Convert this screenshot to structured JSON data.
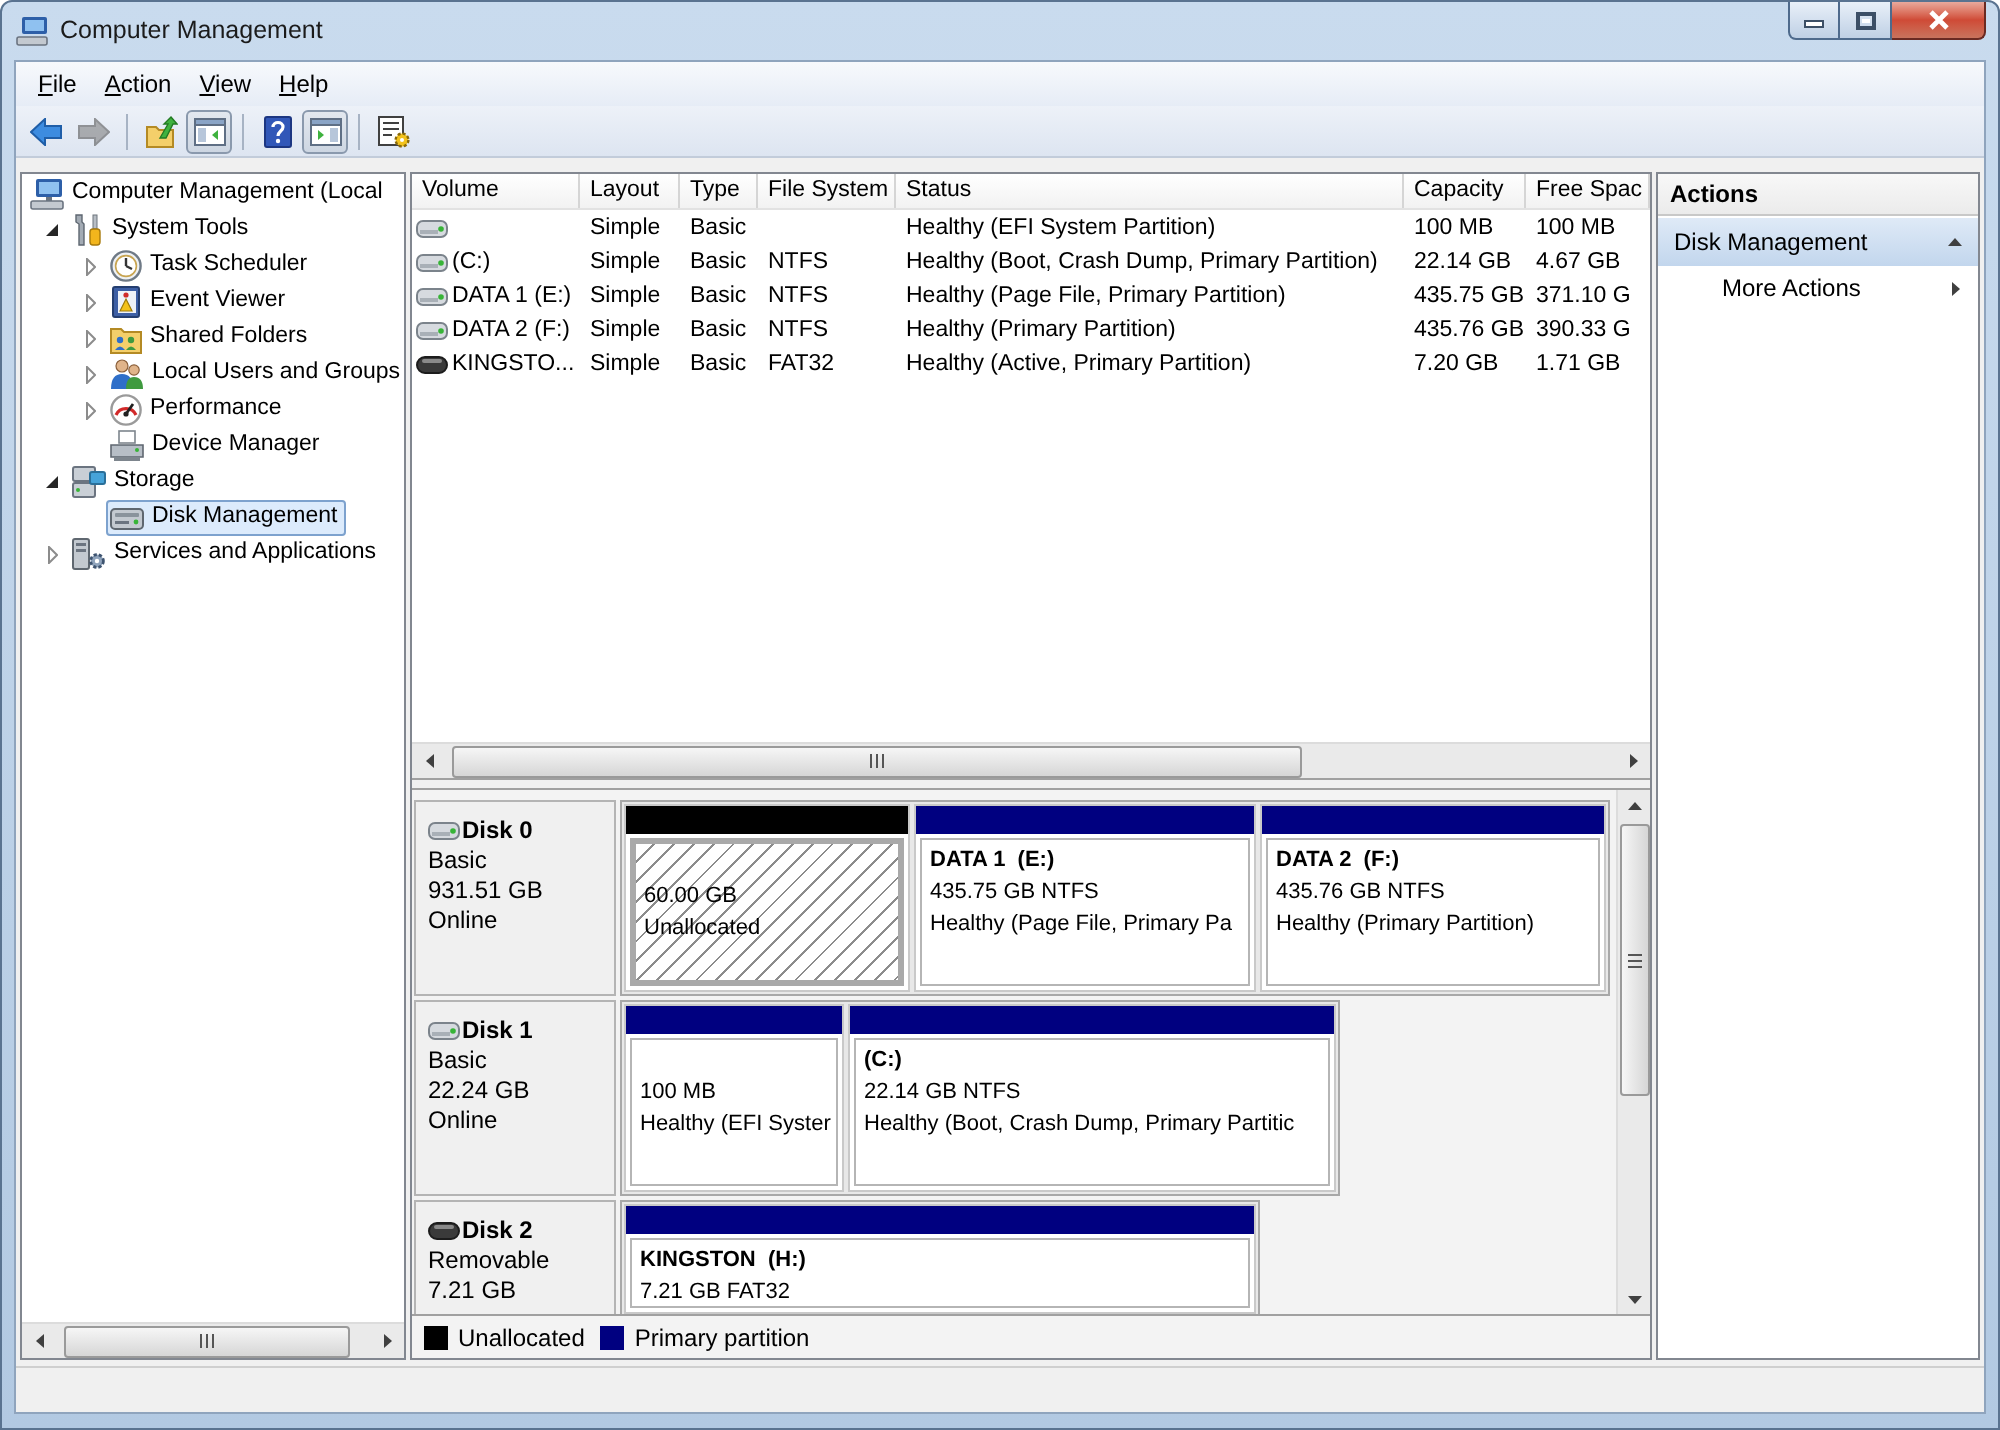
{
  "window": {
    "title": "Computer Management"
  },
  "menu": [
    "File",
    "Action",
    "View",
    "Help"
  ],
  "toolbar": [
    {
      "disabled": false,
      "pressed": false
    },
    {
      "disabled": true,
      "pressed": false
    },
    {
      "disabled": false,
      "pressed": false
    },
    {
      "disabled": false,
      "pressed": true
    },
    {
      "disabled": false,
      "pressed": false
    },
    {
      "disabled": false,
      "pressed": true
    },
    {
      "disabled": false,
      "pressed": false
    }
  ],
  "tree": [
    {
      "label": "Computer Management (Local",
      "selected": false,
      "children": [
        {
          "label": "System Tools",
          "expanded": true,
          "selected": false,
          "children": [
            {
              "label": "Task Scheduler",
              "expanded": false,
              "selected": false
            },
            {
              "label": "Event Viewer",
              "expanded": false,
              "selected": false
            },
            {
              "label": "Shared Folders",
              "expanded": false,
              "selected": false
            },
            {
              "label": "Local Users and Groups",
              "expanded": false,
              "selected": false
            },
            {
              "label": "Performance",
              "expanded": false,
              "selected": false
            },
            {
              "label": "Device Manager",
              "selected": false
            }
          ]
        },
        {
          "label": "Storage",
          "expanded": true,
          "selected": false,
          "children": [
            {
              "label": "Disk Management",
              "selected": true
            }
          ]
        },
        {
          "label": "Services and Applications",
          "expanded": false,
          "selected": false
        }
      ]
    }
  ],
  "volume_list": {
    "columns": [
      "Volume",
      "Layout",
      "Type",
      "File System",
      "Status",
      "Capacity",
      "Free Spac"
    ],
    "rows": [
      {
        "kind": "fixed",
        "layout": "Simple",
        "type": "Basic",
        "status": "Healthy (EFI System Partition)",
        "capacity": "100 MB",
        "column_7": "100 MB"
      },
      {
        "kind": "fixed",
        "volume": "(C:)",
        "layout": "Simple",
        "type": "Basic",
        "file_system": "NTFS",
        "status": "Healthy (Boot, Crash Dump, Primary Partition)",
        "capacity": "22.14 GB",
        "column_7": "4.67 GB"
      },
      {
        "kind": "fixed",
        "volume": "DATA 1 (E:)",
        "layout": "Simple",
        "type": "Basic",
        "file_system": "NTFS",
        "status": "Healthy (Page File, Primary Partition)",
        "capacity": "435.75 GB",
        "column_7": "371.10 G"
      },
      {
        "kind": "fixed",
        "volume": "DATA 2 (F:)",
        "layout": "Simple",
        "type": "Basic",
        "file_system": "NTFS",
        "status": "Healthy (Primary Partition)",
        "capacity": "435.76 GB",
        "column_7": "390.33 G"
      },
      {
        "kind": "removable",
        "volume": "KINGSTO...",
        "layout": "Simple",
        "type": "Basic",
        "file_system": "FAT32",
        "status": "Healthy (Active, Primary Partition)",
        "capacity": "7.20 GB",
        "column_7": "1.71 GB"
      }
    ]
  },
  "disks": [
    {
      "kind": "fixed",
      "name": "Disk 0",
      "type": "Basic",
      "size": "931.51 GB",
      "status": "Online",
      "partitions": [
        {
          "kind": "unallocated",
          "color": "#000000",
          "selected": true,
          "size": "60.00 GB",
          "status": "Unallocated"
        },
        {
          "kind": "primary",
          "color": "#000080",
          "selected": false,
          "name": "DATA 1  (E:)",
          "size": "435.75 GB NTFS",
          "status": "Healthy (Page File, Primary Pa"
        },
        {
          "kind": "primary",
          "color": "#000080",
          "selected": false,
          "name": "DATA 2  (F:)",
          "size": "435.76 GB NTFS",
          "status": "Healthy (Primary Partition)"
        }
      ]
    },
    {
      "kind": "fixed",
      "name": "Disk 1",
      "type": "Basic",
      "size": "22.24 GB",
      "status": "Online",
      "partitions": [
        {
          "kind": "primary",
          "color": "#000080",
          "selected": false,
          "size": "100 MB",
          "status": "Healthy (EFI Syster"
        },
        {
          "kind": "primary",
          "color": "#000080",
          "selected": false,
          "name": "(C:)",
          "size": "22.14 GB NTFS",
          "status": "Healthy (Boot, Crash Dump, Primary Partitic"
        }
      ]
    },
    {
      "kind": "removable",
      "name": "Disk 2",
      "type": "Removable",
      "size": "7.21 GB",
      "partitions": [
        {
          "kind": "primary",
          "color": "#000080",
          "selected": false,
          "name": "KINGSTON  (H:)",
          "size": "7.21 GB FAT32"
        }
      ]
    }
  ],
  "legend": [
    {
      "label": "Unallocated",
      "color": "#000000"
    },
    {
      "label": "Primary partition",
      "color": "#000080"
    }
  ],
  "actions": {
    "title": "Actions",
    "sections": [
      {
        "label": "Disk Management",
        "expanded": true,
        "items": [
          "More Actions"
        ]
      }
    ]
  }
}
